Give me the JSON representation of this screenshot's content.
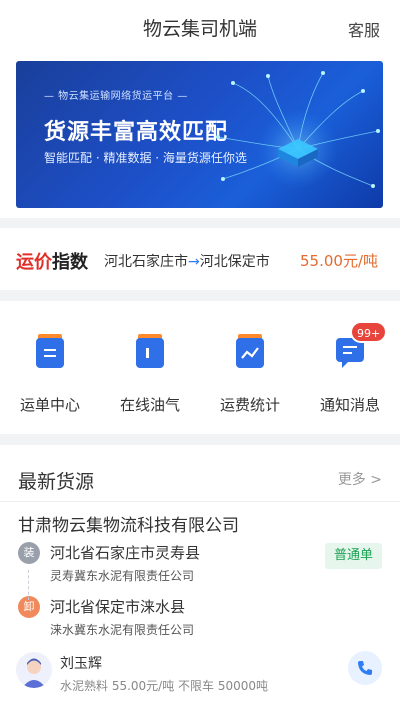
{
  "header": {
    "title": "物云集司机端",
    "service_label": "客服"
  },
  "banner": {
    "platform_text": "— 物云集运输网络货运平台 —",
    "headline": "货源丰富高效匹配",
    "subline": "智能匹配 · 精准数据 · 海量货源任你选"
  },
  "freight_index": {
    "logo_part1": "运价",
    "logo_part2": "指数",
    "origin": "河北石家庄市",
    "arrow": "→",
    "destination": "河北保定市",
    "price": "55.00元/吨"
  },
  "menu": {
    "items": [
      {
        "label": "运单中心",
        "icon": "document-icon"
      },
      {
        "label": "在线油气",
        "icon": "fuel-icon"
      },
      {
        "label": "运费统计",
        "icon": "chart-icon"
      },
      {
        "label": "通知消息",
        "icon": "message-icon",
        "badge": "99+"
      }
    ]
  },
  "latest": {
    "title": "最新货源",
    "more_label": "更多 >",
    "listing": {
      "company": "甘肃物云集物流科技有限公司",
      "tag": "普通单",
      "load": {
        "marker": "装",
        "place": "河北省石家庄市灵寿县",
        "firm": "灵寿冀东水泥有限责任公司"
      },
      "unload": {
        "marker": "卸",
        "place": "河北省保定市涞水县",
        "firm": "涞水冀东水泥有限责任公司"
      },
      "driver_name": "刘玉辉",
      "cargo_info": "水泥熟料 55.00元/吨 不限车 50000吨"
    }
  },
  "colors": {
    "accent_blue": "#2f7df6",
    "price_orange": "#e46a2e",
    "badge_red": "#e7453c",
    "tag_green": "#1aa352"
  }
}
